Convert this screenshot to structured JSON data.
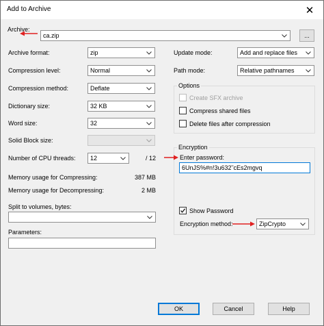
{
  "window": {
    "title": "Add to Archive",
    "close_glyph": "✕"
  },
  "archive": {
    "label": "Archive:",
    "value": "ca.zip",
    "browse_label": "..."
  },
  "left": {
    "archive_format": {
      "label": "Archive format:",
      "value": "zip"
    },
    "compression_level": {
      "label": "Compression level:",
      "value": "Normal"
    },
    "compression_method": {
      "label": "Compression method:",
      "value": "Deflate"
    },
    "dictionary_size": {
      "label": "Dictionary size:",
      "value": "32 KB"
    },
    "word_size": {
      "label": "Word size:",
      "value": "32"
    },
    "solid_block_size": {
      "label": "Solid Block size:",
      "value": ""
    },
    "cpu_threads": {
      "label": "Number of CPU threads:",
      "value": "12",
      "max": "/ 12"
    },
    "memory_compressing": {
      "label": "Memory usage for Compressing:",
      "value": "387 MB"
    },
    "memory_decompressing": {
      "label": "Memory usage for Decompressing:",
      "value": "2 MB"
    },
    "split_volumes": {
      "label": "Split to volumes, bytes:",
      "value": ""
    },
    "parameters": {
      "label": "Parameters:",
      "value": ""
    }
  },
  "right": {
    "update_mode": {
      "label": "Update mode:",
      "value": "Add and replace files"
    },
    "path_mode": {
      "label": "Path mode:",
      "value": "Relative pathnames"
    },
    "options": {
      "title": "Options",
      "create_sfx": {
        "label": "Create SFX archive",
        "checked": false,
        "enabled": false
      },
      "compress_shared": {
        "label": "Compress shared files",
        "checked": false,
        "enabled": true
      },
      "delete_after": {
        "label": "Delete files after compression",
        "checked": false,
        "enabled": true
      }
    },
    "encryption": {
      "title": "Encryption",
      "password_label": "Enter password:",
      "password_value": "6UnJS%#n!3u632˜cEs2mgvq",
      "show_password": {
        "label": "Show Password",
        "checked": true
      },
      "method_label": "Encryption method:",
      "method_value": "ZipCrypto"
    }
  },
  "buttons": {
    "ok": "OK",
    "cancel": "Cancel",
    "help": "Help"
  },
  "colors": {
    "annotation_arrow": "#e02020",
    "focus_border": "#0078d7"
  }
}
